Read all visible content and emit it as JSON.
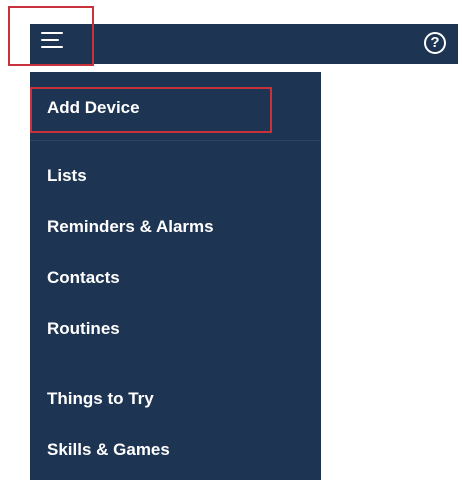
{
  "topbar": {
    "menu_icon": "hamburger-menu-icon",
    "help_icon": "help-question-icon",
    "help_glyph": "?"
  },
  "menu": {
    "items": [
      {
        "label": "Add Device"
      },
      {
        "label": "Lists"
      },
      {
        "label": "Reminders & Alarms"
      },
      {
        "label": "Contacts"
      },
      {
        "label": "Routines"
      },
      {
        "label": "Things to Try"
      },
      {
        "label": "Skills & Games"
      }
    ]
  },
  "colors": {
    "bar_background": "#1e3453",
    "highlight": "#c8323c",
    "text": "#ffffff"
  }
}
